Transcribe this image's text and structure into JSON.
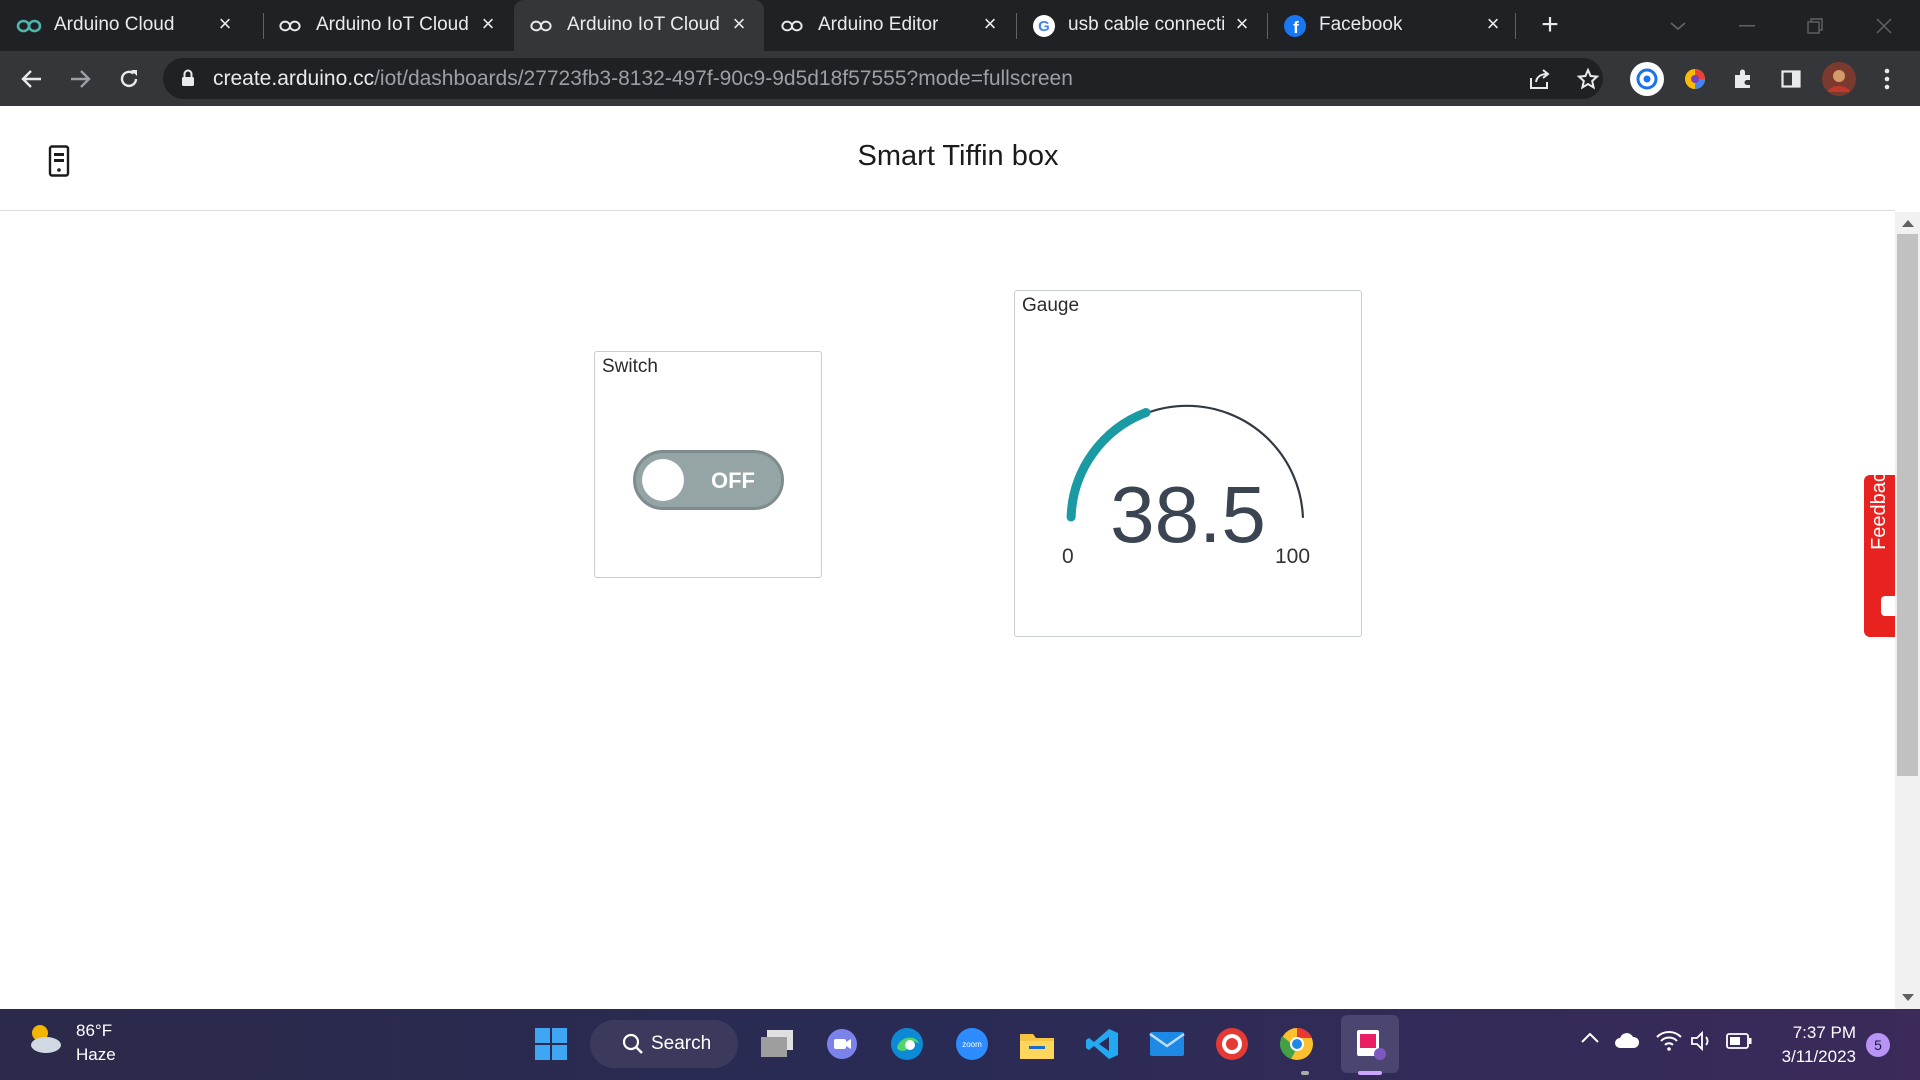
{
  "browser": {
    "tabs": [
      {
        "title": "Arduino Cloud",
        "icon": "arduino-icon",
        "active": false
      },
      {
        "title": "Arduino IoT Cloud",
        "icon": "arduino-icon",
        "active": false
      },
      {
        "title": "Arduino IoT Cloud",
        "icon": "arduino-icon",
        "active": true
      },
      {
        "title": "Arduino Editor",
        "icon": "arduino-icon",
        "active": false
      },
      {
        "title": "usb cable connectic",
        "icon": "google-icon",
        "active": false
      },
      {
        "title": "Facebook",
        "icon": "facebook-icon",
        "active": false
      }
    ],
    "url_host": "create.arduino.cc",
    "url_path": "/iot/dashboards/27723fb3-8132-497f-90c9-9d5d18f57555?mode=fullscreen"
  },
  "dashboard": {
    "title": "Smart Tiffin box",
    "switch": {
      "title": "Switch",
      "state_label": "OFF"
    },
    "gauge": {
      "title": "Gauge",
      "value": "38.5",
      "min": "0",
      "max": "100",
      "fill_fraction": 0.385,
      "accent": "#1a9ba3"
    },
    "feedback_label": "Feedback"
  },
  "taskbar": {
    "weather_temp": "86°F",
    "weather_desc": "Haze",
    "search_label": "Search",
    "time": "7:37 PM",
    "date": "3/11/2023",
    "notifications": "5"
  }
}
